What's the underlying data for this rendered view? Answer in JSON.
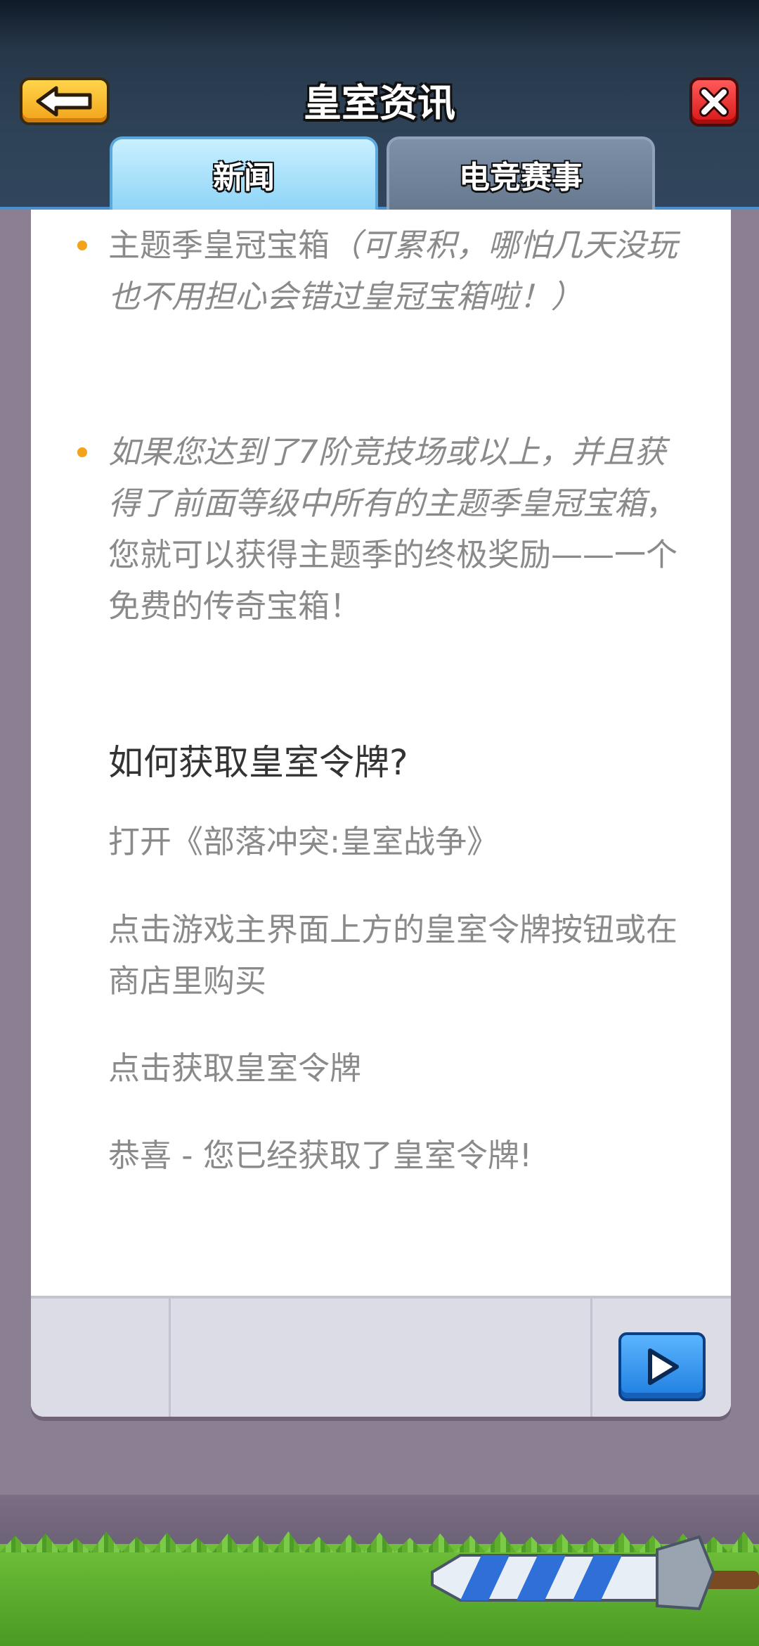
{
  "header": {
    "title": "皇室资讯",
    "back_icon": "back-arrow-icon",
    "close_icon": "close-x-icon"
  },
  "tabs": [
    {
      "label": "新闻",
      "active": true
    },
    {
      "label": "电竞赛事",
      "active": false
    }
  ],
  "article": {
    "bullets": [
      {
        "normal": "主题季皇冠宝箱",
        "italic": "（可累积，哪怕几天没玩也不用担心会错过皇冠宝箱啦！）",
        "rest": ""
      },
      {
        "normal": "",
        "italic": "如果您达到了7阶竞技场或以上，并且获得了前面等级中所有的主题季皇冠宝箱",
        "rest": "，您就可以获得主题季的终极奖励——一个免费的传奇宝箱！"
      }
    ],
    "heading": "如何获取皇室令牌?",
    "steps": [
      "打开《部落冲突:皇室战争》",
      "点击游戏主界面上方的皇室令牌按钮或在商店里购买",
      "点击获取皇室令牌",
      "恭喜 - 您已经获取了皇室令牌!"
    ]
  },
  "footer": {
    "next_icon": "play-next-icon"
  },
  "colors": {
    "bullet_dot": "#f2a31a",
    "header_bg": "#2e4257",
    "tab_active": "#8fd4f7",
    "close_red": "#d81616",
    "next_blue": "#1f7ee0"
  }
}
